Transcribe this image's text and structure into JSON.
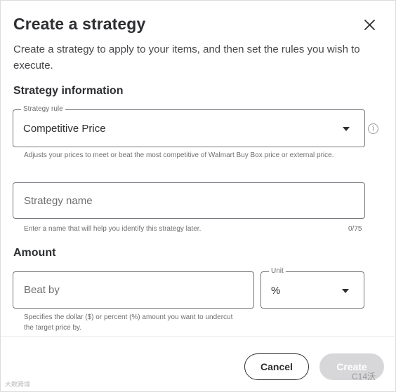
{
  "modal": {
    "title": "Create a strategy",
    "description": "Create a strategy to apply to your items, and then set the rules you wish to execute.",
    "close_icon": "close-icon"
  },
  "strategy_info": {
    "heading": "Strategy information",
    "rule": {
      "label": "Strategy rule",
      "value": "Competitive Price",
      "helper": "Adjusts your prices to meet or beat the most competitive of Walmart Buy Box price or external price.",
      "info_icon": "info-icon"
    },
    "name": {
      "placeholder": "Strategy name",
      "helper": "Enter a name that will help you identify this strategy later.",
      "counter": "0/75"
    }
  },
  "amount": {
    "heading": "Amount",
    "beat_by": {
      "placeholder": "Beat by",
      "helper": "Specifies the dollar ($) or percent (%) amount you want to undercut the target price by."
    },
    "unit": {
      "label": "Unit",
      "value": "%"
    }
  },
  "footer": {
    "cancel_label": "Cancel",
    "create_label": "Create"
  },
  "watermarks": {
    "left": "大数跨境",
    "right": "C14沃"
  },
  "colors": {
    "text": "#2e2f32",
    "border": "#74767c",
    "disabled_button": "#d7d7d9"
  }
}
